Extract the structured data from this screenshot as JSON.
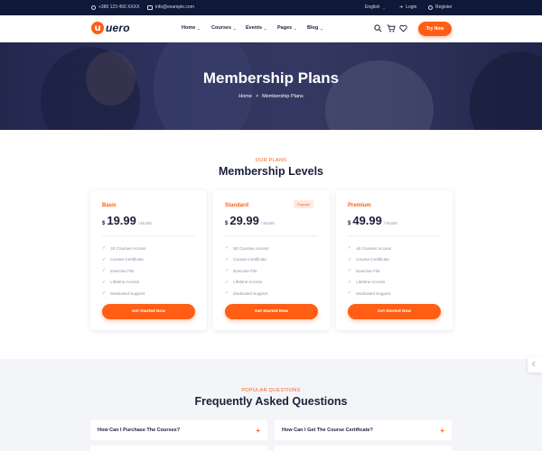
{
  "topbar": {
    "phone": "+380 123 456 XXXX",
    "email": "info@example.com",
    "language": "English",
    "login": "Login",
    "register": "Register"
  },
  "header": {
    "logo_letter": "u",
    "logo_word": "uero",
    "nav": [
      {
        "label": "Home"
      },
      {
        "label": "Courses"
      },
      {
        "label": "Events"
      },
      {
        "label": "Pages"
      },
      {
        "label": "Blog"
      }
    ],
    "icons": [
      "search-icon",
      "cart-icon",
      "heart-icon"
    ],
    "cta": "Try Now"
  },
  "hero": {
    "title": "Membership Plans",
    "breadcrumb_home": "Home",
    "breadcrumb_separator": ">",
    "breadcrumb_current": "Membership Plans"
  },
  "plans": {
    "eyebrow": "OUR PLANS",
    "title": "Membership Levels",
    "currency": "$",
    "period": "/ Month",
    "cards": [
      {
        "name": "Basic",
        "price": "19.99",
        "badge": "",
        "features": [
          "20 Courses Access",
          "Course Certificate",
          "Exercise File",
          "Lifetime Access",
          "Dedicated Support"
        ],
        "button": "Get Started Now"
      },
      {
        "name": "Standard",
        "price": "29.99",
        "badge": "Popular",
        "features": [
          "50 Courses Access",
          "Course Certificate",
          "Exercise File",
          "Lifetime Access",
          "Dedicated Support"
        ],
        "button": "Get Started Now"
      },
      {
        "name": "Premium",
        "price": "49.99",
        "badge": "",
        "features": [
          "all Courses Access",
          "Course Certificate",
          "Exercise File",
          "Lifetime Access",
          "Dedicated Support"
        ],
        "button": "Get Started Now"
      }
    ]
  },
  "faq": {
    "eyebrow": "POPULAR QUESTIONS",
    "title": "Frequently Asked Questions",
    "questions": [
      "How Can I Purchase The Courses?",
      "How Can I Get The Course Certificate?"
    ]
  },
  "colors": {
    "accent": "#ff5e14",
    "topbar": "#0f1836",
    "heading": "#1b1f3b"
  }
}
